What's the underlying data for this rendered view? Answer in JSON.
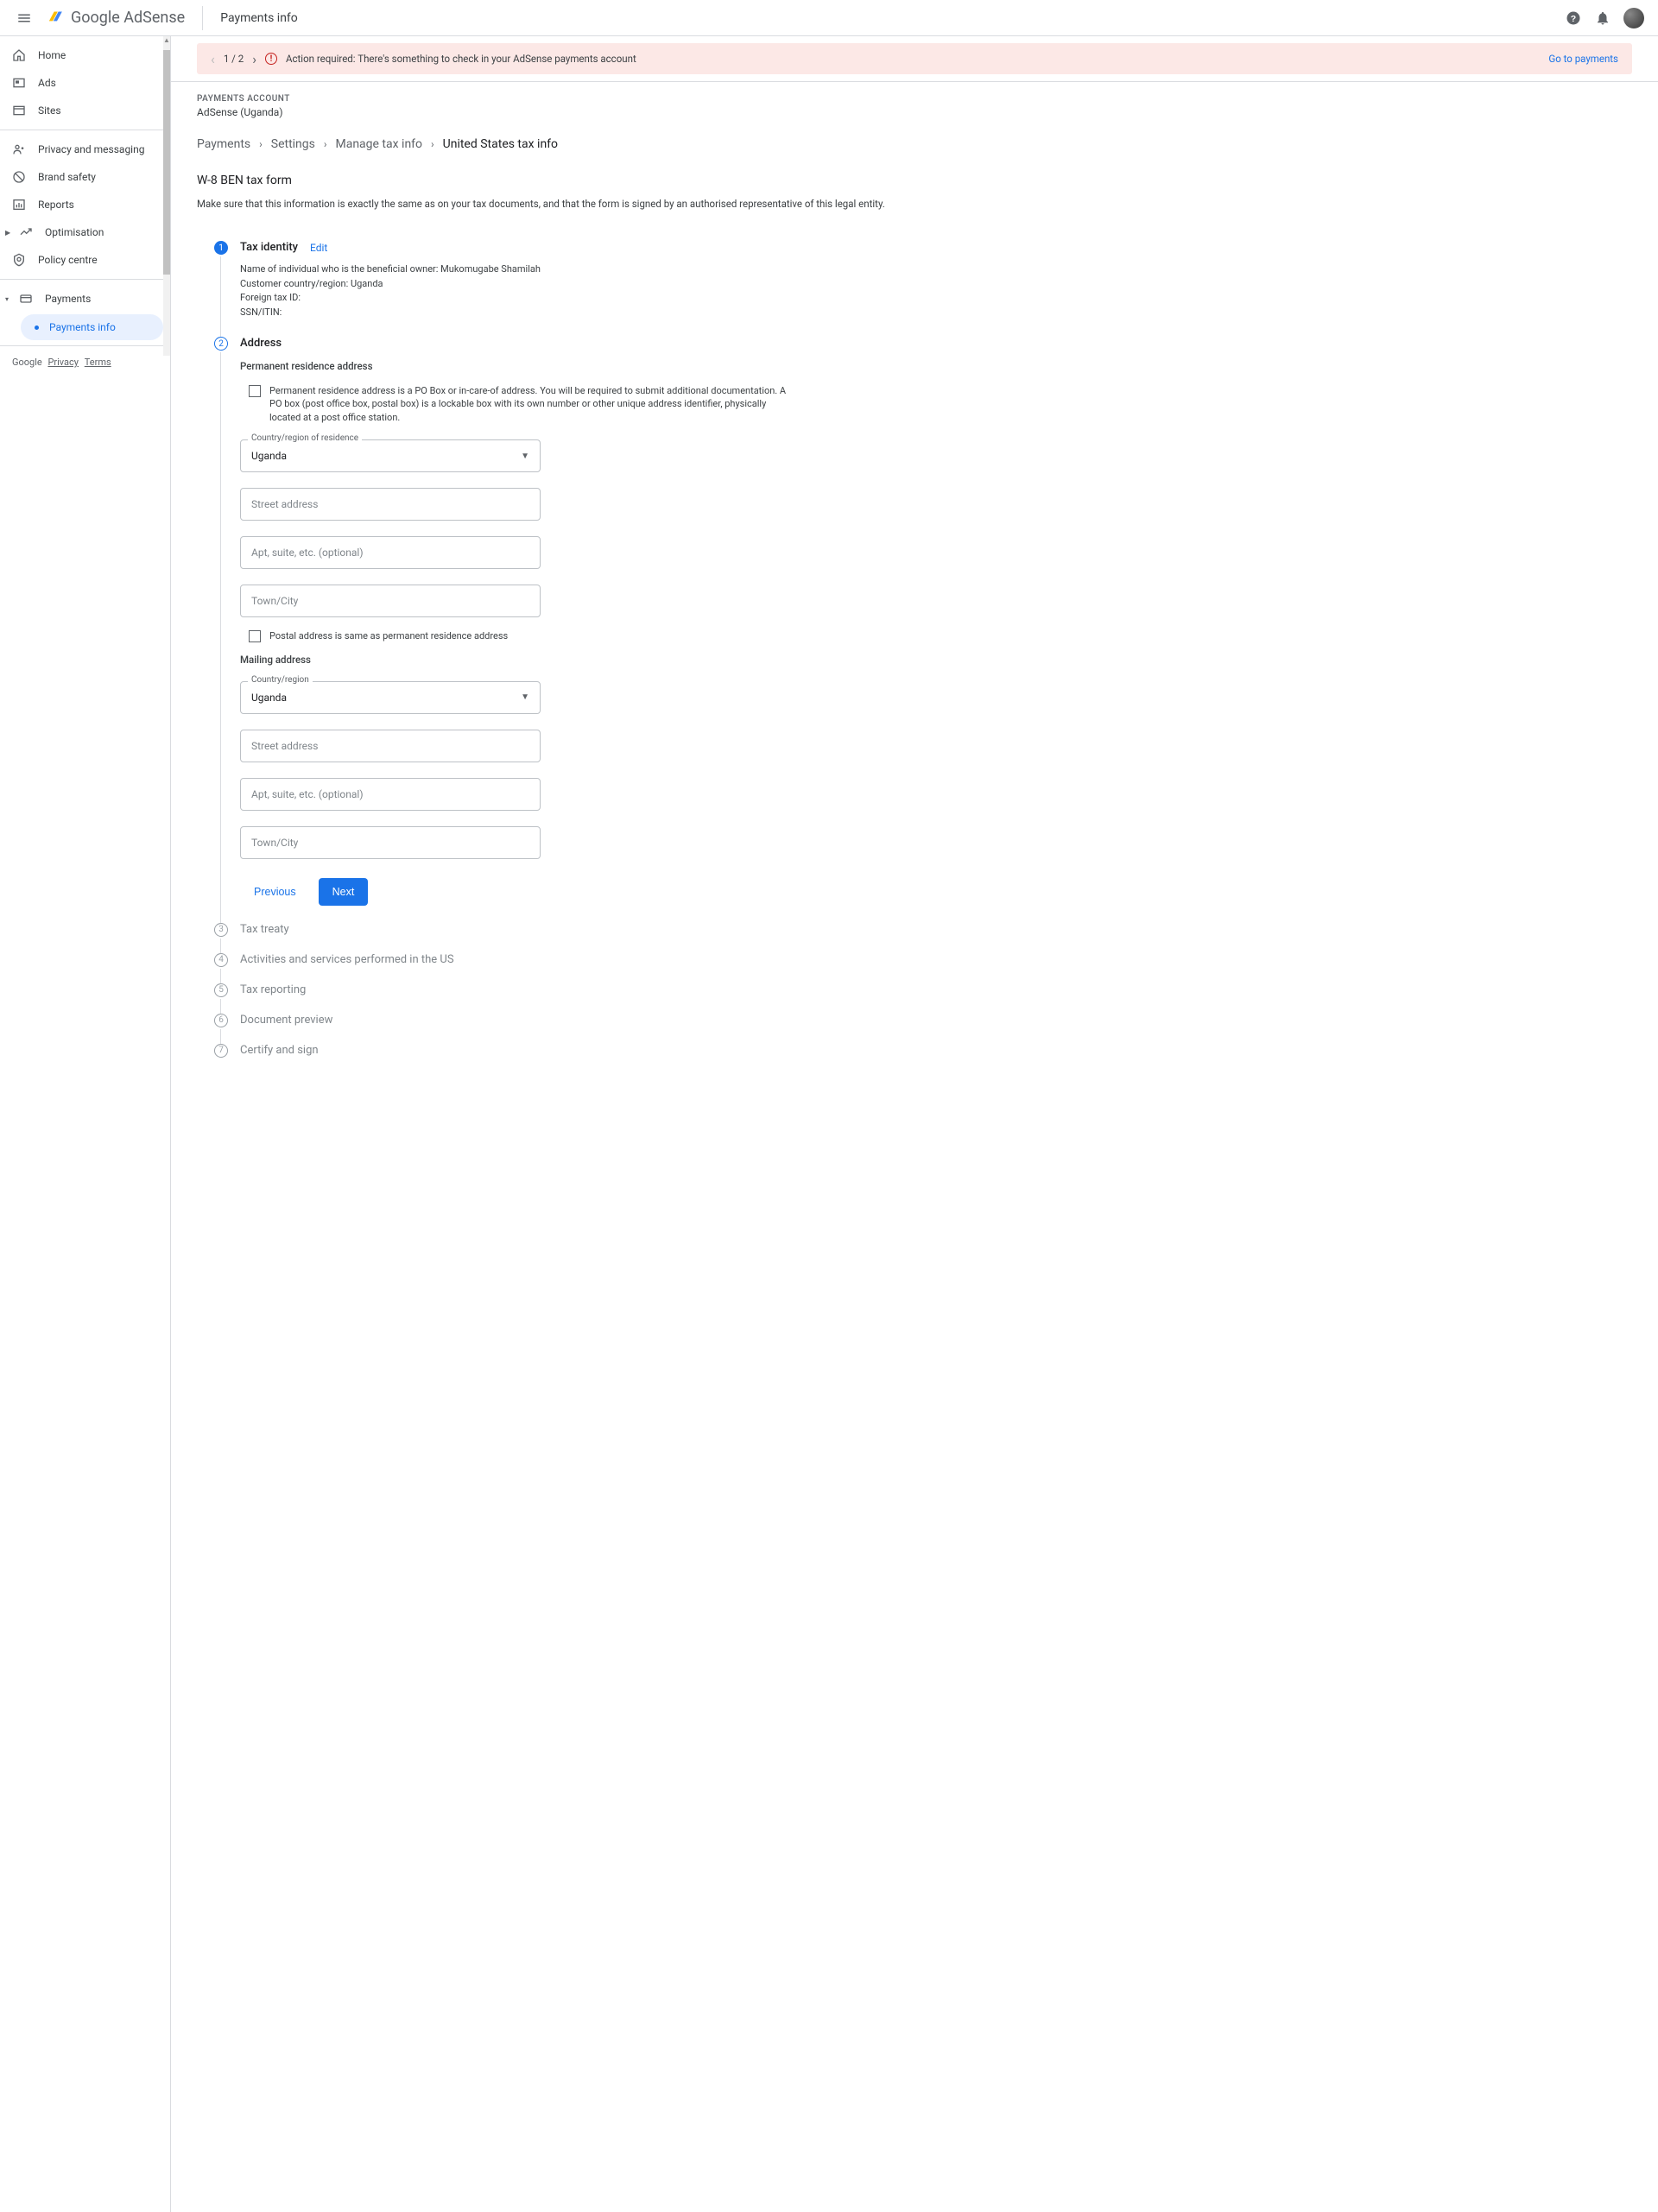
{
  "header": {
    "product": "Google AdSense",
    "page_title": "Payments info"
  },
  "sidebar": {
    "items": [
      "Home",
      "Ads",
      "Sites",
      "Privacy and messaging",
      "Brand safety",
      "Reports",
      "Optimisation",
      "Policy centre",
      "Payments"
    ],
    "sub_item": "Payments info",
    "footer": {
      "brand": "Google",
      "privacy": "Privacy",
      "terms": "Terms"
    }
  },
  "alert": {
    "pager": "1 / 2",
    "text": "Action required: There's something to check in your AdSense payments account",
    "link": "Go to payments"
  },
  "account": {
    "label": "PAYMENTS ACCOUNT",
    "name": "AdSense (Uganda)"
  },
  "breadcrumb": [
    "Payments",
    "Settings",
    "Manage tax info",
    "United States tax info"
  ],
  "form": {
    "title": "W-8 BEN tax form",
    "desc": "Make sure that this information is exactly the same as on your tax documents, and that the form is signed by an authorised representative of this legal entity."
  },
  "steps": {
    "s1": {
      "title": "Tax identity",
      "edit": "Edit",
      "rows": [
        "Name of individual who is the beneficial owner: Mukomugabe Shamilah",
        "Customer country/region: Uganda",
        "Foreign tax ID:",
        "SSN/ITIN:"
      ]
    },
    "s2": {
      "title": "Address",
      "perm_head": "Permanent residence address",
      "po_box_text": "Permanent residence address is a PO Box or in-care-of address. You will be required to submit additional documentation. A PO box (post office box, postal box) is a lockable box with its own number or other unique address identifier, physically located at a post office station.",
      "country_label": "Country/region of residence",
      "country_val": "Uganda",
      "street_ph": "Street address",
      "apt_ph": "Apt, suite, etc. (optional)",
      "city_ph": "Town/City",
      "same_as": "Postal address is same as permanent residence address",
      "mail_head": "Mailing address",
      "mail_country_label": "Country/region",
      "mail_country_val": "Uganda",
      "prev": "Previous",
      "next": "Next"
    },
    "s3": "Tax treaty",
    "s4": "Activities and services performed in the US",
    "s5": "Tax reporting",
    "s6": "Document preview",
    "s7": "Certify and sign"
  }
}
